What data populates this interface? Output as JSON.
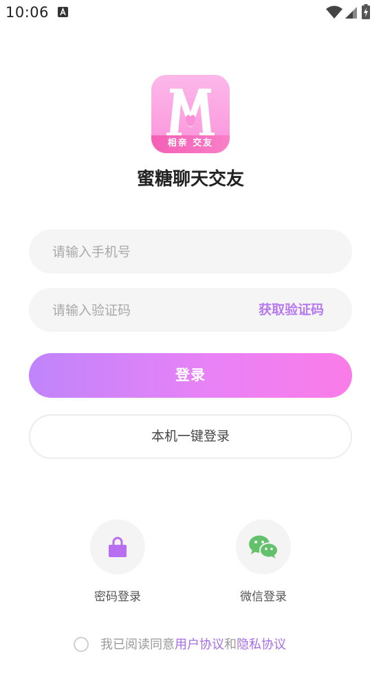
{
  "status_bar": {
    "time": "10:06",
    "notification_icon": "text-a-icon",
    "icons": [
      "wifi-icon",
      "signal-icon",
      "battery-charging-icon"
    ]
  },
  "app": {
    "logo_letter": "M",
    "logo_band_text": "相亲 交友",
    "name": "蜜糖聊天交友",
    "accent_color": "#b77af0"
  },
  "form": {
    "phone_placeholder": "请输入手机号",
    "phone_value": "",
    "code_placeholder": "请输入验证码",
    "code_value": "",
    "get_code_label": "获取验证码",
    "login_label": "登录",
    "onekey_login_label": "本机一键登录"
  },
  "alt_login": {
    "password_label": "密码登录",
    "password_icon": "lock-icon",
    "wechat_label": "微信登录",
    "wechat_icon": "wechat-icon"
  },
  "agreement": {
    "prefix": "我已阅读同意",
    "user_agreement": "用户协议",
    "conjunction": "和",
    "privacy_policy": "隐私协议",
    "checked": false
  }
}
